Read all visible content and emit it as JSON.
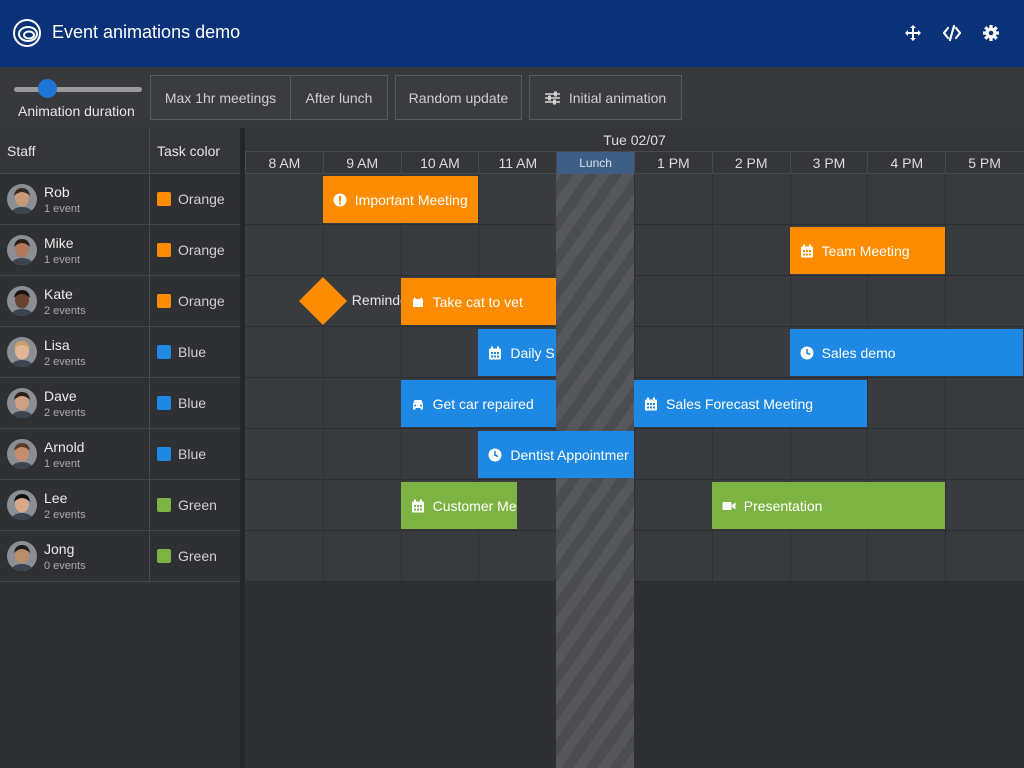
{
  "header": {
    "title": "Event animations demo",
    "icons": [
      "move-icon",
      "code-icon",
      "gear-icon"
    ]
  },
  "toolbar": {
    "slider_label": "Animation duration",
    "slider_value_fraction": 0.25,
    "buttons": [
      "Max 1hr meetings",
      "After lunch",
      "Random update",
      "Initial animation"
    ]
  },
  "grid": {
    "col_staff": "Staff",
    "col_color": "Task color",
    "date": "Tue 02/07",
    "hours": [
      "8 AM",
      "9 AM",
      "10 AM",
      "11 AM",
      "Lunch",
      "1 PM",
      "2 PM",
      "3 PM",
      "4 PM",
      "5 PM"
    ],
    "lunch_label": "Lunch"
  },
  "colors": {
    "Orange": "#fe8c00",
    "Blue": "#1e88e5",
    "Green": "#7cb342",
    "header": "#0b3279"
  },
  "resources": [
    {
      "name": "Rob",
      "events": "1 event",
      "color": "Orange"
    },
    {
      "name": "Mike",
      "events": "1 event",
      "color": "Orange"
    },
    {
      "name": "Kate",
      "events": "2 events",
      "color": "Orange"
    },
    {
      "name": "Lisa",
      "events": "2 events",
      "color": "Blue"
    },
    {
      "name": "Dave",
      "events": "2 events",
      "color": "Blue"
    },
    {
      "name": "Arnold",
      "events": "1 event",
      "color": "Blue"
    },
    {
      "name": "Lee",
      "events": "2 events",
      "color": "Green"
    },
    {
      "name": "Jong",
      "events": "0 events",
      "color": "Green"
    }
  ],
  "events": [
    {
      "name": "Important Meeting",
      "row": 0,
      "start": "9 AM",
      "end": "11 AM",
      "icon": "exclamation-icon",
      "color": "Orange"
    },
    {
      "name": "Team Meeting",
      "row": 1,
      "start": "3 PM",
      "end": "5 PM",
      "icon": "calendar-icon",
      "color": "Orange"
    },
    {
      "name": "Take cat to vet",
      "row": 2,
      "start": "10 AM",
      "end": "12 PM",
      "icon": "cat-icon",
      "color": "Orange"
    },
    {
      "name": "Daily S",
      "row": 3,
      "start": "11 AM",
      "end": "12 PM",
      "icon": "calendar-icon",
      "color": "Blue"
    },
    {
      "name": "Sales demo",
      "row": 3,
      "start": "3 PM",
      "end": "6 PM",
      "icon": "clock-icon",
      "color": "Blue"
    },
    {
      "name": "Get car repaired",
      "row": 4,
      "start": "10 AM",
      "end": "12 PM",
      "icon": "car-icon",
      "color": "Blue"
    },
    {
      "name": "Sales Forecast Meeting",
      "row": 4,
      "start": "1 PM",
      "end": "4 PM",
      "icon": "calendar-icon",
      "color": "Blue"
    },
    {
      "name": "Dentist Appointmer",
      "row": 5,
      "start": "11 AM",
      "end": "1 PM",
      "icon": "clock-icon",
      "color": "Blue"
    },
    {
      "name": "Customer Me",
      "row": 6,
      "start": "10 AM",
      "end": "11:30 AM",
      "icon": "calendar-icon",
      "color": "Green"
    },
    {
      "name": "Presentation",
      "row": 6,
      "start": "2 PM",
      "end": "5 PM",
      "icon": "video-icon",
      "color": "Green"
    }
  ],
  "milestones": [
    {
      "name": "Reminde",
      "row": 2,
      "time": "9 AM",
      "color": "Orange"
    }
  ]
}
